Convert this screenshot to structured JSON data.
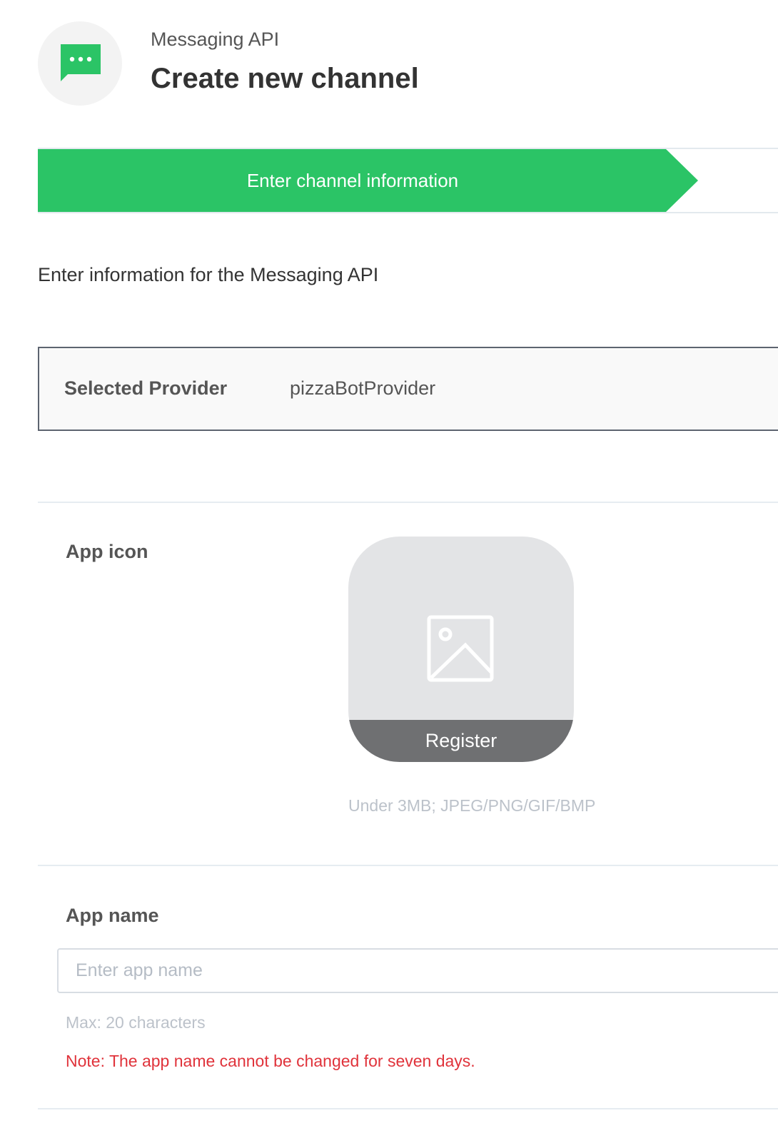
{
  "header": {
    "service_name": "Messaging API",
    "title": "Create new channel",
    "logo_icon": "chat-bubble-icon",
    "brand_color": "#2bc466"
  },
  "steps": {
    "current_label": "Enter channel information"
  },
  "intro_text": "Enter information for the Messaging API",
  "provider": {
    "label": "Selected Provider",
    "value": "pizzaBotProvider"
  },
  "app_icon": {
    "label": "App icon",
    "placeholder_icon": "image-icon",
    "register_label": "Register",
    "hint": "Under 3MB; JPEG/PNG/GIF/BMP"
  },
  "app_name": {
    "label": "App name",
    "value": "",
    "placeholder": "Enter app name",
    "hint": "Max: 20 characters",
    "note": "Note: The app name cannot be changed for seven days."
  }
}
